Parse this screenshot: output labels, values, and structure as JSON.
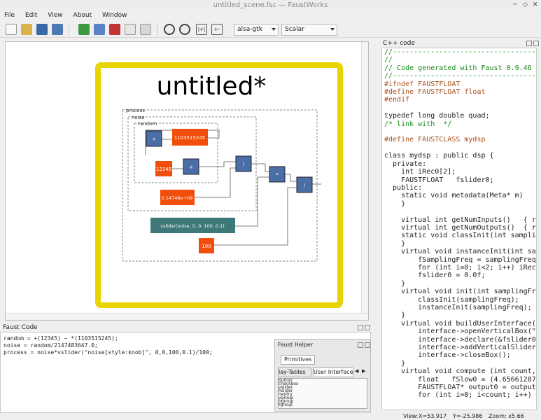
{
  "window": {
    "title": "untitled_scene.fsc — FaustWorks"
  },
  "menu": [
    "File",
    "Edit",
    "View",
    "About",
    "Window"
  ],
  "toolbar": {
    "audio_driver": "alsa-gtk",
    "mode": "Scalar"
  },
  "diagram": {
    "title": "untitled*",
    "group_labels": [
      "process",
      "noise",
      "random"
    ],
    "blocks": [
      "+",
      "1103515245",
      "12345",
      "+",
      "/",
      "*",
      "/",
      "2.14748e+09",
      "vslider(noise, 0, 0, 100, 0.1)",
      "100"
    ]
  },
  "faust_code": {
    "title": "Faust Code",
    "lines": [
      "random = +(12345) ~ *(1103515245);",
      "noise = random/2147483647.0;",
      "process = noise*vslider(\"noise[style:knob]\", 0,0,100,0.1)/100;"
    ]
  },
  "helper": {
    "title": "Faust Helper",
    "tab_primitives": "Primitives",
    "tab_tables": "lay-Tables",
    "tab_ui": "User Interface",
    "items": [
      "button",
      "checkbox",
      "vslider",
      "hslider",
      "nentry",
      "vgroup",
      "hgroup",
      "tgroup"
    ]
  },
  "cpp": {
    "title": "C++ code",
    "lines": [
      "//-----------------------------------",
      "//",
      "// Code generated with Faust 0.9.46 (",
      "//-----------------------------------",
      "#ifndef FAUSTFLOAT",
      "#define FAUSTFLOAT float",
      "#endif",
      "",
      "typedef long double quad;",
      "/* link with  */",
      "",
      "#define FAUSTCLASS mydsp",
      "",
      "class mydsp : public dsp {",
      "  private:",
      "    int iRec0[2];",
      "    FAUSTFLOAT   fslider0;",
      "  public:",
      "    static void metadata(Meta* m)",
      "    }",
      "",
      "    virtual int getNumInputs()   { re",
      "    virtual int getNumOutputs()  { re",
      "    static void classInit(int samplin",
      "    }",
      "    virtual void instanceInit(int sam",
      "        fSamplingFreq = samplingFreq;",
      "        for (int i=0; i<2; i++) iRec0",
      "        fslider0 = 0.0f;",
      "    }",
      "    virtual void init(int samplingFre",
      "        classInit(samplingFreq);",
      "        instanceInit(samplingFreq);",
      "    }",
      "    virtual void buildUserInterface(U",
      "        interface->openVerticalBox(\"u",
      "        interface->declare(&fslider0,",
      "        interface->addVerticalSlider(",
      "        interface->closeBox();",
      "    }",
      "    virtual void compute (int count,",
      "        float   fSlow0 = (4.65661287",
      "        FAUSTFLOAT* output0 = output[",
      "        for (int i=0; i<count; i++) {"
    ]
  },
  "status": {
    "view": "View:",
    "x": "X=53.917",
    "y": "Y=-25.986",
    "zoom": "Zoom: x5.66"
  }
}
